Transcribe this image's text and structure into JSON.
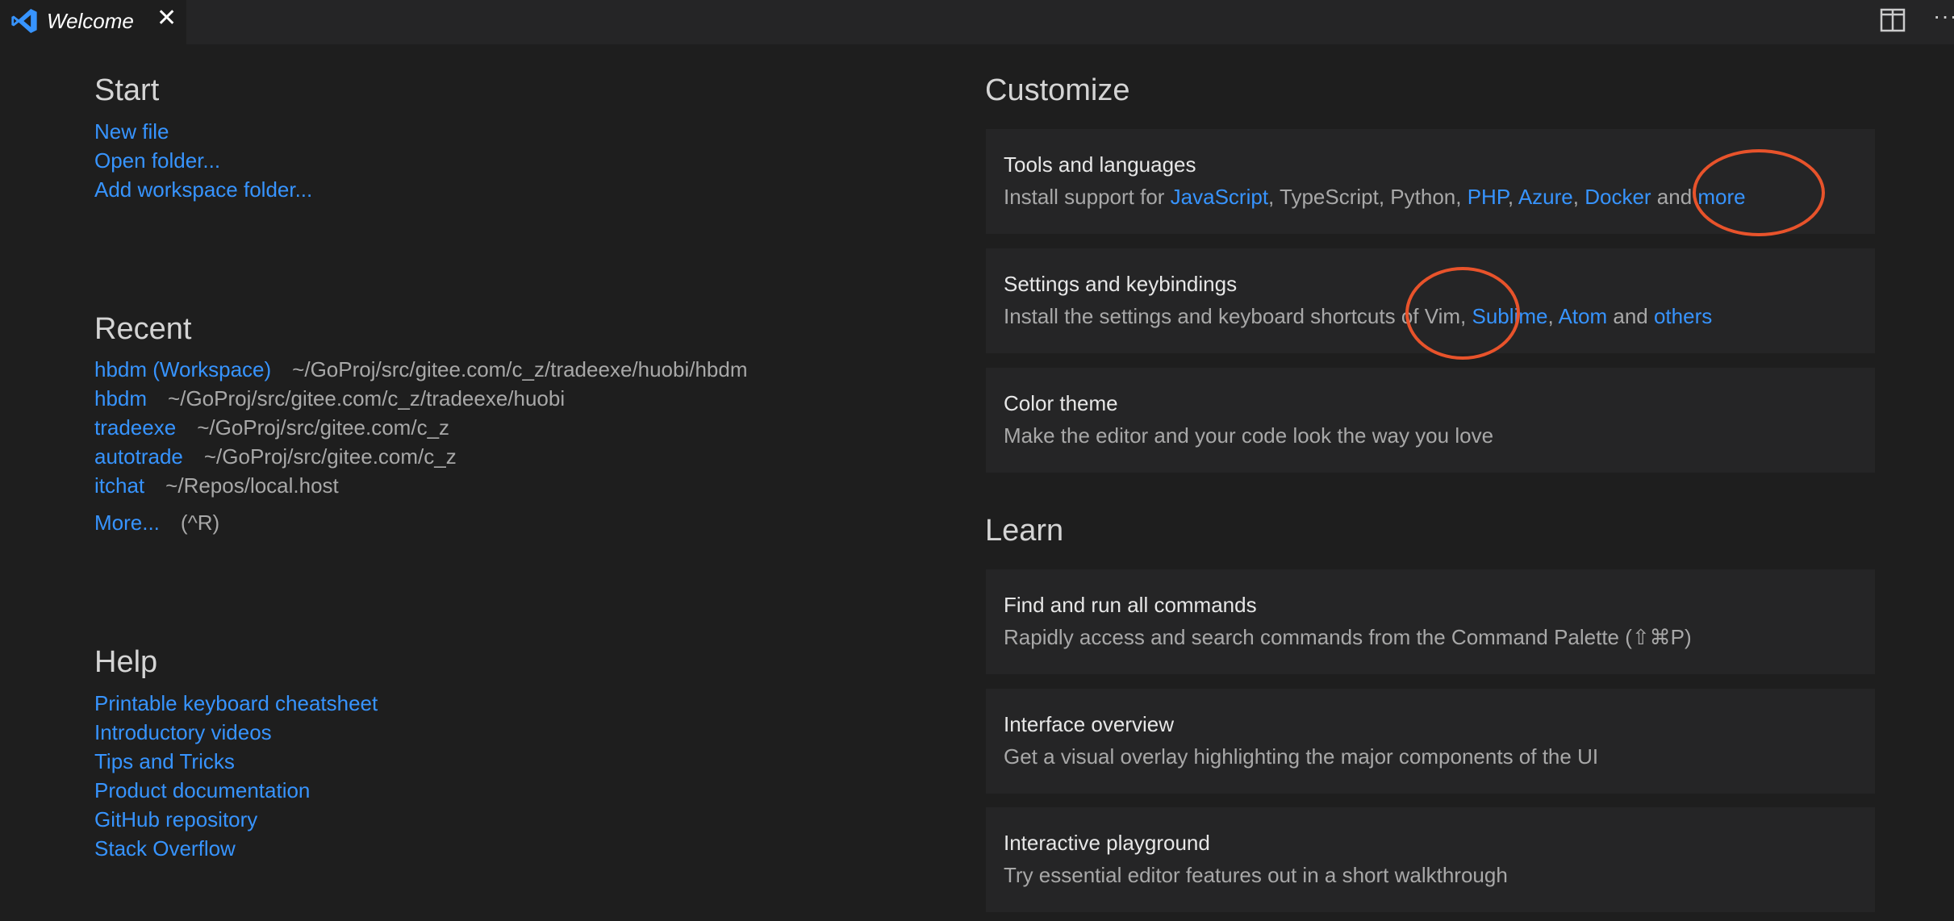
{
  "tab": {
    "label": "Welcome",
    "close_glyph": "✕",
    "icon": "vscode-logo-icon"
  },
  "toolbar": {
    "split_icon": "split-editor-icon",
    "more_glyph": "···"
  },
  "start": {
    "title": "Start",
    "links": [
      "New file",
      "Open folder...",
      "Add workspace folder..."
    ]
  },
  "recent": {
    "title": "Recent",
    "items": [
      {
        "name": "hbdm (Workspace)",
        "path": "~/GoProj/src/gitee.com/c_z/tradeexe/huobi/hbdm"
      },
      {
        "name": "hbdm",
        "path": "~/GoProj/src/gitee.com/c_z/tradeexe/huobi"
      },
      {
        "name": "tradeexe",
        "path": "~/GoProj/src/gitee.com/c_z"
      },
      {
        "name": "autotrade",
        "path": "~/GoProj/src/gitee.com/c_z"
      },
      {
        "name": "itchat",
        "path": "~/Repos/local.host"
      }
    ],
    "more_label": "More...",
    "more_shortcut": "(^R)"
  },
  "help": {
    "title": "Help",
    "links": [
      "Printable keyboard cheatsheet",
      "Introductory videos",
      "Tips and Tricks",
      "Product documentation",
      "GitHub repository",
      "Stack Overflow"
    ]
  },
  "customize": {
    "title": "Customize",
    "tools": {
      "title": "Tools and languages",
      "prefix": "Install support for ",
      "js": "JavaScript",
      "mid": ", TypeScript, Python, ",
      "php": "PHP",
      "sep1": ", ",
      "azure": "Azure",
      "sep2": ", ",
      "docker": "Docker",
      "and": " and ",
      "more": "more"
    },
    "settings": {
      "title": "Settings and keybindings",
      "prefix": "Install the settings and keyboard shortcuts of Vim, ",
      "sublime": "Sublime",
      "sep": ", ",
      "atom": "Atom",
      "and": " and ",
      "others": "others"
    },
    "theme": {
      "title": "Color theme",
      "desc": "Make the editor and your code look the way you love"
    }
  },
  "learn": {
    "title": "Learn",
    "cards": [
      {
        "title": "Find and run all commands",
        "desc": "Rapidly access and search commands from the Command Palette (⇧⌘P)"
      },
      {
        "title": "Interface overview",
        "desc": "Get a visual overlay highlighting the major components of the UI"
      },
      {
        "title": "Interactive playground",
        "desc": "Try essential editor features out in a short walkthrough"
      }
    ]
  },
  "colors": {
    "link": "#3794ff",
    "annotation": "#e8532b",
    "background": "#1e1e1e",
    "card": "#252526"
  }
}
